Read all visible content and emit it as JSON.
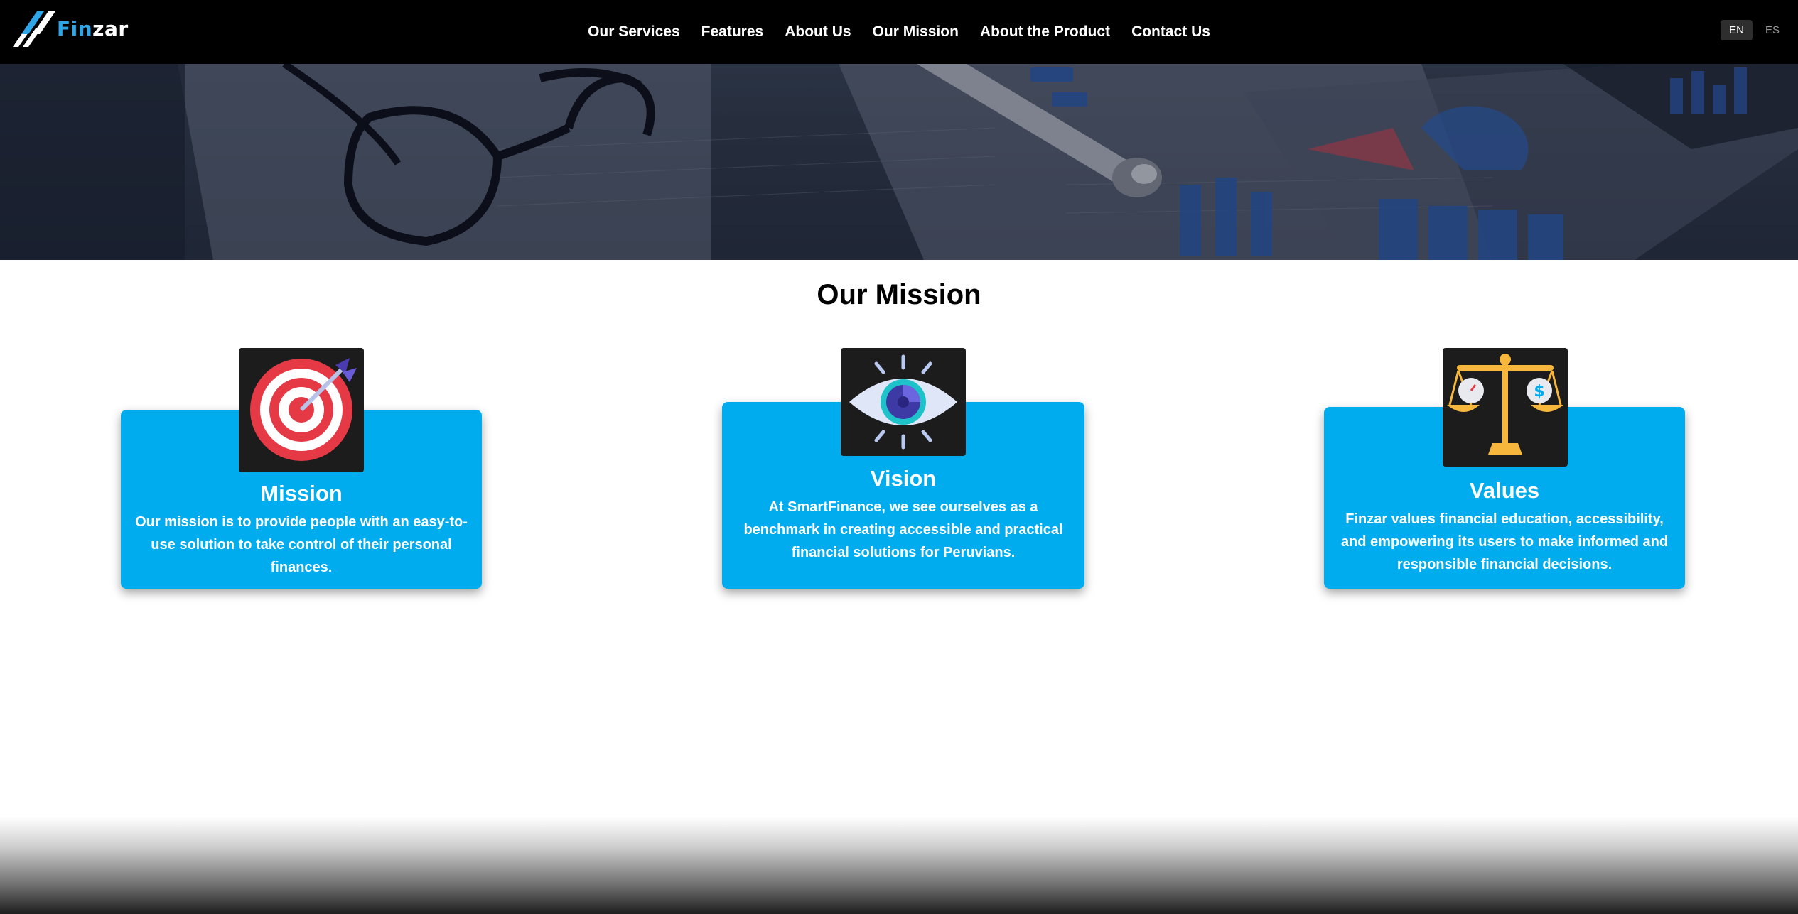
{
  "brand": {
    "name_part1": "Fin",
    "name_part2": "zar",
    "accent": "#2fa6e8"
  },
  "nav": {
    "items": [
      {
        "label": "Our Services"
      },
      {
        "label": "Features"
      },
      {
        "label": "About Us"
      },
      {
        "label": "Our Mission"
      },
      {
        "label": "About the Product"
      },
      {
        "label": "Contact Us"
      }
    ]
  },
  "lang": {
    "en": "EN",
    "es": "ES",
    "selected": "EN"
  },
  "section": {
    "title": "Our Mission"
  },
  "cards": [
    {
      "title": "Mission",
      "icon": "target-icon",
      "text": "Our mission is to provide people with an easy-to-use solution to take control of their personal finances."
    },
    {
      "title": "Vision",
      "icon": "eye-icon",
      "text": "At SmartFinance, we see ourselves as a benchmark in creating accessible and practical financial solutions for Peruvians."
    },
    {
      "title": "Values",
      "icon": "scales-icon",
      "text": "Finzar values financial education, accessibility, and empowering its users to make informed and responsible financial decisions."
    }
  ],
  "colors": {
    "card": "#00acee",
    "nav": "#000000",
    "icon_bg": "#1c1c1c"
  }
}
